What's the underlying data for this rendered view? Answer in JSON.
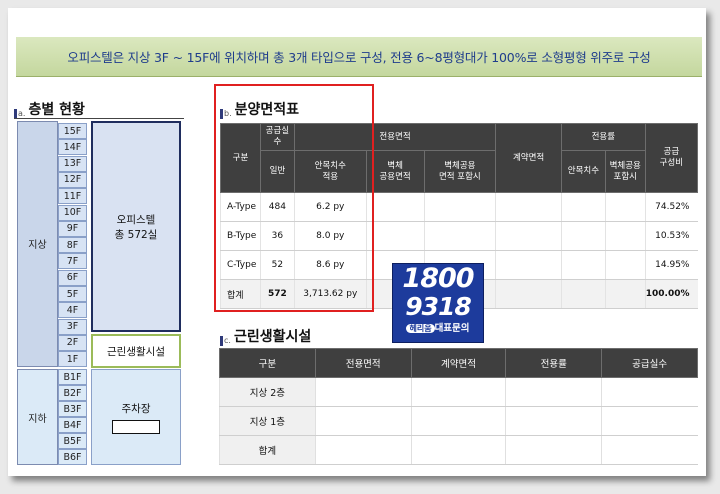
{
  "banner": "오피스텔은 지상 3F ~ 15F에 위치하며 총 3개 타입으로 구성, 전용 6~8평형대가 100%로 소형평형 위주로 구성",
  "section_a": {
    "badge": "a.",
    "title": "층별 현황"
  },
  "section_b": {
    "badge": "b.",
    "title": "분양면적표"
  },
  "section_c": {
    "badge": "c.",
    "title": "근린생활시설"
  },
  "floors": {
    "above_label": "지상",
    "below_label": "지하",
    "above": [
      "15F",
      "14F",
      "13F",
      "12F",
      "11F",
      "10F",
      "9F",
      "8F",
      "7F",
      "6F",
      "5F",
      "4F",
      "3F",
      "2F",
      "1F"
    ],
    "below": [
      "B1F",
      "B2F",
      "B3F",
      "B4F",
      "B5F",
      "B6F"
    ],
    "office_name": "오피스텔",
    "office_count": "총 572실",
    "retail": "근린생활시설",
    "parking": "주차장"
  },
  "area_table": {
    "headers": {
      "type": "구분",
      "supply_units": "공급실수",
      "general": "일반",
      "exclusive_area": "전용면적",
      "real_applied": "안목치수\n적용",
      "wall_common": "벽체\n공용면적",
      "wall_included": "벽체공용\n면적 포함시",
      "contract_area": "계약면적",
      "exclusive_rate": "전용률",
      "rate_real": "안목치수",
      "rate_wall": "벽체공용\n포함시",
      "supply_ratio": "공급\n구성비"
    },
    "rows": [
      {
        "type": "A-Type",
        "units": "484",
        "area": "6.2 py",
        "ratio": "74.52%"
      },
      {
        "type": "B-Type",
        "units": "36",
        "area": "8.0 py",
        "ratio": "10.53%"
      },
      {
        "type": "C-Type",
        "units": "52",
        "area": "8.6 py",
        "ratio": "14.95%"
      }
    ],
    "total": {
      "type": "합계",
      "units": "572",
      "area": "3,713.62 py",
      "ratio": "100.00%"
    }
  },
  "retail_table": {
    "headers": [
      "구분",
      "전용면적",
      "계약면적",
      "전용률",
      "공급실수"
    ],
    "rows": [
      "지상 2층",
      "지상 1층",
      "합계"
    ]
  },
  "promo": {
    "line1": "1800",
    "line2": "9318",
    "pill": "헤리움",
    "line3": "대표문의"
  },
  "colors": {
    "banner_text": "#1f3d8c",
    "highlight_border": "#e02020",
    "header_bg": "#3f3f3f",
    "promo_bg": "#1d3b9c"
  }
}
